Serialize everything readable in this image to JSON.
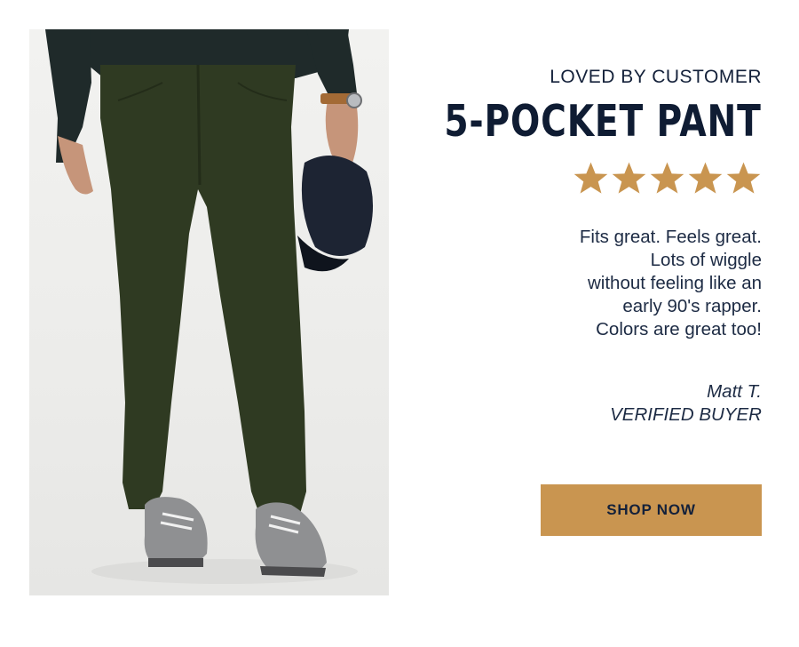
{
  "promo": {
    "eyebrow": "LOVED BY CUSTOMER",
    "title": "5-POCKET PANT",
    "rating_stars": 5,
    "quote_lines": [
      "Fits great. Feels great.",
      "Lots of wiggle",
      "without feeling like an",
      "early 90's rapper.",
      "Colors are great too!"
    ],
    "author_name": "Matt T.",
    "author_badge": "VERIFIED BUYER",
    "cta_label": "SHOP NOW"
  },
  "colors": {
    "text": "#14213a",
    "star": "#c99550",
    "button": "#c99550",
    "pant": "#2f3a22"
  },
  "icons": {
    "rating": "star-icon"
  }
}
